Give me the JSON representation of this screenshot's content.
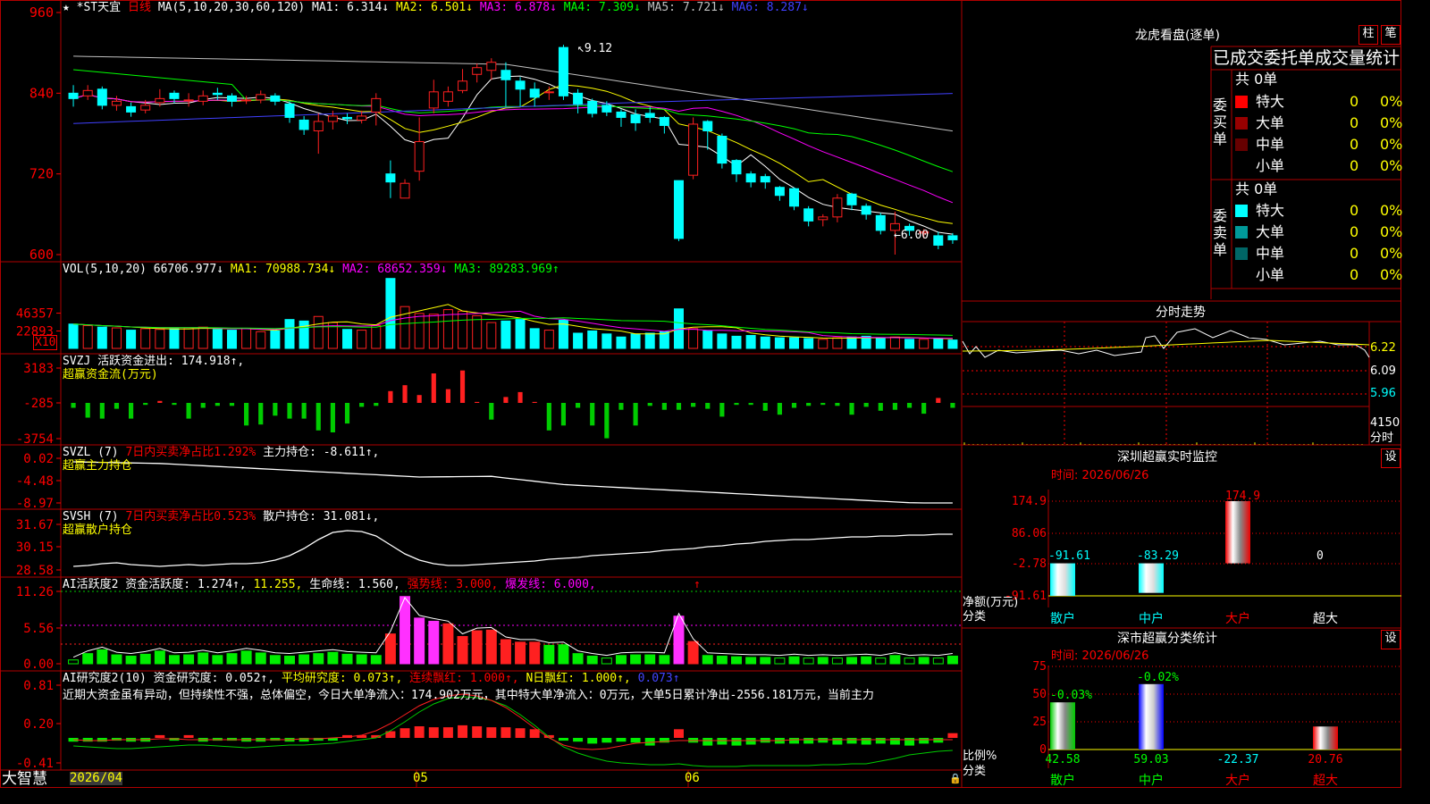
{
  "left_panel": {
    "pane1": {
      "title": "*ST天宜",
      "period": "日线",
      "ma_label": "MA(5,10,20,30,60,120)",
      "ma_values": [
        {
          "text": "MA1: 6.314↓",
          "color": "#ffffff"
        },
        {
          "text": "MA2: 6.501↓",
          "color": "#ffff00"
        },
        {
          "text": "MA3: 6.878↓",
          "color": "#ff00ff"
        },
        {
          "text": "MA4: 7.309↓",
          "color": "#00ff00"
        },
        {
          "text": "MA5: 7.721↓",
          "color": "#c0c0c0"
        },
        {
          "text": "MA6: 8.287↓",
          "color": "#4040ff"
        }
      ],
      "y_ticks": [
        "960",
        "840",
        "720",
        "600"
      ],
      "high_mark": "9.12",
      "low_mark": "6.00"
    },
    "pane2": {
      "label": "VOL(5,10,20)",
      "value": "66706.977↓",
      "ma_values": [
        {
          "text": "MA1: 70988.734↓",
          "color": "#ffff00"
        },
        {
          "text": "MA2: 68652.359↓",
          "color": "#ff00ff"
        },
        {
          "text": "MA3: 89283.969↑",
          "color": "#00ff00"
        }
      ],
      "y_ticks": [
        "46357",
        "22893"
      ],
      "unit": "X10"
    },
    "pane3": {
      "label": "SVZJ",
      "line1": "活跃资金进出: 174.918↑,",
      "line2": "超赢资金流(万元)",
      "y_ticks": [
        "3183",
        "-285",
        "-3754"
      ]
    },
    "pane4": {
      "label": "SVZL (7)",
      "part1": "7日内买卖净占比1.292%",
      "part2": "主力持仓: -8.611↑,",
      "line2": "超赢主力持仓",
      "y_ticks": [
        "0.02",
        "-4.48",
        "-8.97"
      ]
    },
    "pane5": {
      "label": "SVSH (7)",
      "part1": "7日内买卖净占比0.523%",
      "part2": "散户持仓: 31.081↓,",
      "line2": "超赢散户持仓",
      "y_ticks": [
        "31.67",
        "30.15",
        "28.58"
      ]
    },
    "pane6": {
      "label": "AI活跃度2 资金活跃度: 1.274↑,",
      "part1": "11.255,",
      "part2": "生命线: 1.560,",
      "part3": "强势线: 3.000,",
      "part4": "爆发线: 6.000,",
      "part5": "↑",
      "y_ticks": [
        "11.26",
        "5.56",
        "0.00"
      ]
    },
    "pane7": {
      "label": "AI研究度2(10) 资金研究度: 0.052↑,",
      "part1": "平均研究度: 0.073↑,",
      "part2": "连续飘红: 1.000↑,",
      "part3": "N日飘红: 1.000↑,",
      "part4": "0.073↑",
      "commentary": "近期大资金虽有异动，但持续性不强，总体偏空，今日大单净流入：174.902万元，其中特大单净流入：0万元，大单5日累计净出-2556.181万元，当前主力",
      "y_ticks": [
        "0.81",
        "0.20",
        "-0.41"
      ]
    },
    "xaxis": {
      "brand": "大智慧",
      "dates": [
        "2026/04",
        "05",
        "06"
      ]
    }
  },
  "right_panel": {
    "dragon": {
      "title": "龙虎看盘(逐单)",
      "btn_bar": "柱",
      "btn_pen": "笔",
      "header": "已成交委托单成交量统计",
      "buy_side_label": "委买单",
      "sell_side_label": "委卖单",
      "buy_total": "共 0单",
      "sell_total": "共 0单",
      "buy_rows": [
        {
          "name": "特大",
          "count": "0",
          "pct": "0%",
          "color": "#ff0000"
        },
        {
          "name": "大单",
          "count": "0",
          "pct": "0%",
          "color": "#990000"
        },
        {
          "name": "中单",
          "count": "0",
          "pct": "0%",
          "color": "#660000"
        },
        {
          "name": "小单",
          "count": "0",
          "pct": "0%",
          "color": "#000000"
        }
      ],
      "sell_rows": [
        {
          "name": "特大",
          "count": "0",
          "pct": "0%",
          "color": "#00ffff"
        },
        {
          "name": "大单",
          "count": "0",
          "pct": "0%",
          "color": "#009999"
        },
        {
          "name": "中单",
          "count": "0",
          "pct": "0%",
          "color": "#006666"
        },
        {
          "name": "小单",
          "count": "0",
          "pct": "0%",
          "color": "#000000"
        }
      ]
    },
    "intraday": {
      "title": "分时走势",
      "y_ticks": [
        "6.22",
        "6.09",
        "5.96",
        "4150",
        "分时"
      ]
    },
    "monitor": {
      "title": "深圳超赢实时监控",
      "btn": "设",
      "time_label": "时间: 2026/06/26",
      "y_ticks": [
        "174.9",
        "86.06",
        "-2.78",
        "-91.61"
      ],
      "y_caption": "净额(万元)",
      "x_caption": "分类",
      "categories": [
        "散户",
        "中户",
        "大户",
        "超大"
      ],
      "values": [
        -91.61,
        -83.29,
        174.9,
        0
      ],
      "value_labels": [
        "-91.61",
        "-83.29",
        "174.9",
        "0"
      ]
    },
    "classify": {
      "title": "深市超赢分类统计",
      "btn": "设",
      "time_label": "时间: 2026/06/26",
      "y_ticks": [
        "75",
        "50",
        "25",
        "0"
      ],
      "y_caption": "比例%",
      "x_caption": "分类",
      "categories": [
        "散户",
        "中户",
        "大户",
        "超大"
      ],
      "values": [
        42.58,
        59.03,
        -22.37,
        20.76
      ],
      "value_labels": [
        "42.58",
        "59.03",
        "-22.37",
        "20.76"
      ],
      "top_labels": [
        "-0.03%",
        "-0.02%"
      ]
    }
  },
  "chart_data": {
    "type": "candlestick",
    "series": [
      {
        "name": "K",
        "values": [
          [
            8.4,
            8.32,
            8.52,
            8.2
          ],
          [
            8.36,
            8.44,
            8.52,
            8.3
          ],
          [
            8.46,
            8.22,
            8.5,
            8.16
          ],
          [
            8.22,
            8.28,
            8.36,
            8.14
          ],
          [
            8.2,
            8.12,
            8.26,
            8.05
          ],
          [
            8.15,
            8.22,
            8.3,
            8.1
          ],
          [
            8.26,
            8.32,
            8.46,
            8.2
          ],
          [
            8.4,
            8.32,
            8.44,
            8.25
          ],
          [
            8.3,
            8.3,
            8.4,
            8.2
          ],
          [
            8.28,
            8.36,
            8.44,
            8.22
          ],
          [
            8.4,
            8.38,
            8.48,
            8.3
          ],
          [
            8.36,
            8.28,
            8.4,
            8.2
          ],
          [
            8.3,
            8.3,
            8.36,
            8.24
          ],
          [
            8.3,
            8.38,
            8.44,
            8.25
          ],
          [
            8.36,
            8.28,
            8.4,
            8.22
          ],
          [
            8.24,
            8.04,
            8.28,
            7.96
          ],
          [
            8.0,
            7.86,
            8.06,
            7.78
          ],
          [
            7.84,
            7.98,
            8.1,
            7.5
          ],
          [
            7.98,
            8.06,
            8.14,
            7.86
          ],
          [
            8.04,
            8.02,
            8.1,
            7.94
          ],
          [
            8.0,
            8.06,
            8.14,
            7.95
          ],
          [
            8.12,
            8.32,
            8.4,
            7.92
          ],
          [
            7.2,
            7.08,
            7.4,
            6.84
          ],
          [
            6.84,
            7.06,
            7.12,
            6.84
          ],
          [
            7.24,
            7.68,
            8.04,
            7.1
          ],
          [
            8.18,
            8.42,
            8.6,
            8.1
          ],
          [
            8.28,
            8.42,
            8.5,
            8.2
          ],
          [
            8.44,
            8.58,
            8.76,
            8.4
          ],
          [
            8.68,
            8.78,
            8.84,
            8.56
          ],
          [
            8.74,
            8.86,
            8.92,
            8.6
          ],
          [
            8.74,
            8.6,
            8.86,
            8.2
          ],
          [
            8.58,
            8.46,
            8.64,
            8.2
          ],
          [
            8.46,
            8.34,
            8.56,
            8.2
          ],
          [
            8.42,
            8.42,
            8.5,
            8.3
          ],
          [
            9.08,
            8.36,
            9.12,
            8.3
          ],
          [
            8.4,
            8.24,
            8.46,
            8.1
          ],
          [
            8.28,
            8.1,
            8.32,
            8.04
          ],
          [
            8.22,
            8.12,
            8.28,
            8.06
          ],
          [
            8.12,
            8.04,
            8.16,
            7.9
          ],
          [
            8.08,
            7.96,
            8.16,
            7.84
          ],
          [
            8.1,
            8.04,
            8.2,
            7.96
          ],
          [
            8.04,
            7.92,
            8.06,
            7.8
          ],
          [
            7.1,
            6.24,
            7.1,
            6.2
          ],
          [
            7.18,
            7.94,
            8.04,
            7.12
          ],
          [
            7.98,
            7.84,
            8.0,
            7.56
          ],
          [
            7.76,
            7.36,
            7.8,
            7.28
          ],
          [
            7.4,
            7.2,
            7.42,
            7.08
          ],
          [
            7.2,
            7.08,
            7.24,
            7.0
          ],
          [
            7.16,
            7.08,
            7.2,
            6.98
          ],
          [
            7.0,
            6.88,
            7.02,
            6.8
          ],
          [
            6.98,
            6.72,
            7.0,
            6.66
          ],
          [
            6.68,
            6.5,
            6.72,
            6.42
          ],
          [
            6.52,
            6.56,
            6.6,
            6.42
          ],
          [
            6.56,
            6.84,
            6.9,
            6.48
          ],
          [
            6.9,
            6.74,
            6.92,
            6.66
          ],
          [
            6.72,
            6.6,
            6.76,
            6.52
          ],
          [
            6.58,
            6.36,
            6.62,
            6.3
          ],
          [
            6.36,
            6.46,
            6.64,
            6.0
          ],
          [
            6.42,
            6.36,
            6.46,
            6.28
          ],
          [
            6.32,
            6.34,
            6.38,
            6.24
          ],
          [
            6.28,
            6.14,
            6.34,
            6.08
          ],
          [
            6.28,
            6.22,
            6.32,
            6.16
          ]
        ]
      }
    ],
    "x": [
      "2026/04",
      "05",
      "06"
    ],
    "ylim": [
      5.96,
      9.6
    ],
    "vol": [
      3.2,
      3.0,
      2.8,
      2.7,
      2.4,
      2.6,
      2.5,
      2.6,
      2.7,
      2.8,
      2.5,
      2.4,
      2.6,
      2.2,
      2.3,
      3.8,
      3.6,
      4.2,
      3.4,
      2.5,
      2.4,
      3.0,
      9.2,
      5.5,
      4.6,
      4.5,
      5.1,
      4.9,
      4.3,
      3.4,
      3.6,
      3.8,
      2.6,
      2.4,
      3.7,
      2.0,
      2.3,
      1.9,
      1.5,
      1.9,
      2.0,
      2.2,
      5.2,
      2.6,
      2.3,
      1.9,
      1.6,
      1.7,
      1.5,
      1.4,
      1.4,
      1.3,
      1.2,
      1.4,
      1.5,
      1.6,
      1.3,
      1.5,
      1.2,
      1.2,
      1.3,
      1.1
    ]
  }
}
